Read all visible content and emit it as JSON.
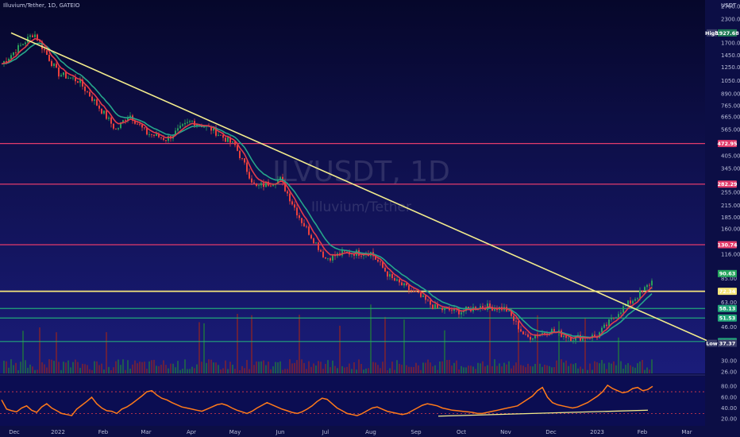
{
  "header": {
    "symbol_line": "Illuvium/Tether, 1D, GATEIO",
    "watermark_main": "ILVUSDT, 1D",
    "watermark_sub": "Illuvium/Tether",
    "currency": "USDT"
  },
  "colors": {
    "background_top": "#06072b",
    "background_bottom": "#1a1c7a",
    "up_candle": "#e8403c",
    "down_candle": "#2aa05a",
    "trendline": "#f2eb8c",
    "ema_fast": "#e23b4a",
    "ema_slow": "#26a68a",
    "resistance": "#e23b6b",
    "yellow_level": "#f5e67a",
    "green_level": "#22a67a",
    "rsi_line": "#ff7a1a"
  },
  "chart_data": {
    "type": "candlestick",
    "symbol": "ILVUSDT",
    "interval": "1D",
    "exchange": "GATEIO",
    "y_scale": "log",
    "ylim": [
      26,
      2700
    ],
    "x_ticks": [
      "Dec",
      "2022",
      "Feb",
      "Mar",
      "Apr",
      "May",
      "Jun",
      "Jul",
      "Aug",
      "Sep",
      "Oct",
      "Nov",
      "Dec",
      "2023",
      "Feb",
      "Mar"
    ],
    "y_ticks": [
      "2700.00",
      "2300.00",
      "1700.00",
      "1450.00",
      "1250.00",
      "1050.00",
      "890.00",
      "765.00",
      "665.00",
      "565.00",
      "405.00",
      "345.00",
      "255.00",
      "215.00",
      "185.00",
      "160.00",
      "116.00",
      "85.00",
      "63.00",
      "46.00",
      "30.00",
      "26.00"
    ],
    "close_path": [
      {
        "x": "Dec",
        "y": 1300
      },
      {
        "x": "Dec",
        "y": 1927.68
      },
      {
        "x": "2022",
        "y": 1150
      },
      {
        "x": "2022",
        "y": 1050
      },
      {
        "x": "Feb",
        "y": 700
      },
      {
        "x": "Feb",
        "y": 560
      },
      {
        "x": "Feb",
        "y": 690
      },
      {
        "x": "Mar",
        "y": 540
      },
      {
        "x": "Mar",
        "y": 500
      },
      {
        "x": "Apr",
        "y": 630
      },
      {
        "x": "Apr",
        "y": 570
      },
      {
        "x": "May",
        "y": 460
      },
      {
        "x": "May",
        "y": 270
      },
      {
        "x": "Jun",
        "y": 300
      },
      {
        "x": "Jun",
        "y": 180
      },
      {
        "x": "Jul",
        "y": 110
      },
      {
        "x": "Jul",
        "y": 118
      },
      {
        "x": "Aug",
        "y": 118
      },
      {
        "x": "Aug",
        "y": 85
      },
      {
        "x": "Sep",
        "y": 70
      },
      {
        "x": "Sep",
        "y": 58
      },
      {
        "x": "Oct",
        "y": 56
      },
      {
        "x": "Oct",
        "y": 60
      },
      {
        "x": "Nov",
        "y": 58
      },
      {
        "x": "Nov",
        "y": 40
      },
      {
        "x": "Dec",
        "y": 44
      },
      {
        "x": "Dec",
        "y": 40
      },
      {
        "x": "2023",
        "y": 41
      },
      {
        "x": "2023",
        "y": 55
      },
      {
        "x": "Feb",
        "y": 72
      },
      {
        "x": "Feb",
        "y": 95
      }
    ],
    "levels": [
      {
        "label": "472.95",
        "value": 472.95,
        "kind": "resistance"
      },
      {
        "label": "282.29",
        "value": 282.29,
        "kind": "resistance"
      },
      {
        "label": "130.74",
        "value": 130.74,
        "kind": "resistance"
      },
      {
        "label": "72.34",
        "value": 72.34,
        "kind": "yellow"
      },
      {
        "label": "58.13",
        "value": 58.13,
        "kind": "support"
      },
      {
        "label": "51.53",
        "value": 51.53,
        "kind": "support"
      },
      {
        "label": "38.22",
        "value": 38.22,
        "kind": "support"
      }
    ],
    "price_tags": {
      "high_label": "High",
      "high_value": "1927.68",
      "low_label": "Low",
      "low_value": "37.37",
      "last_value": "90.63"
    },
    "trendline": {
      "from": {
        "x": "Dec",
        "y": 1927.68
      },
      "to": {
        "x": "Mar",
        "y": 37.37
      }
    },
    "rsi": {
      "ticks": [
        "80.00",
        "60.00",
        "40.00",
        "20.00"
      ],
      "ylim": [
        10,
        95
      ],
      "overbought": 70,
      "oversold": 30,
      "values": [
        55,
        38,
        35,
        33,
        40,
        44,
        36,
        32,
        42,
        48,
        40,
        35,
        30,
        28,
        26,
        38,
        45,
        52,
        60,
        48,
        40,
        35,
        34,
        30,
        38,
        42,
        48,
        55,
        62,
        70,
        72,
        64,
        58,
        55,
        50,
        46,
        42,
        40,
        38,
        36,
        34,
        38,
        42,
        46,
        48,
        45,
        40,
        36,
        33,
        30,
        34,
        40,
        45,
        50,
        46,
        42,
        38,
        35,
        32,
        30,
        33,
        38,
        44,
        52,
        58,
        56,
        48,
        40,
        35,
        30,
        28,
        26,
        30,
        35,
        40,
        42,
        38,
        34,
        32,
        30,
        28,
        30,
        35,
        40,
        45,
        48,
        46,
        44,
        40,
        38,
        36,
        35,
        34,
        33,
        32,
        30,
        30,
        32,
        34,
        36,
        38,
        40,
        42,
        44,
        50,
        56,
        62,
        72,
        78,
        60,
        50,
        46,
        44,
        42,
        40,
        42,
        46,
        50,
        56,
        62,
        70,
        82,
        76,
        72,
        68,
        70,
        76,
        78,
        72,
        74,
        80
      ]
    }
  }
}
